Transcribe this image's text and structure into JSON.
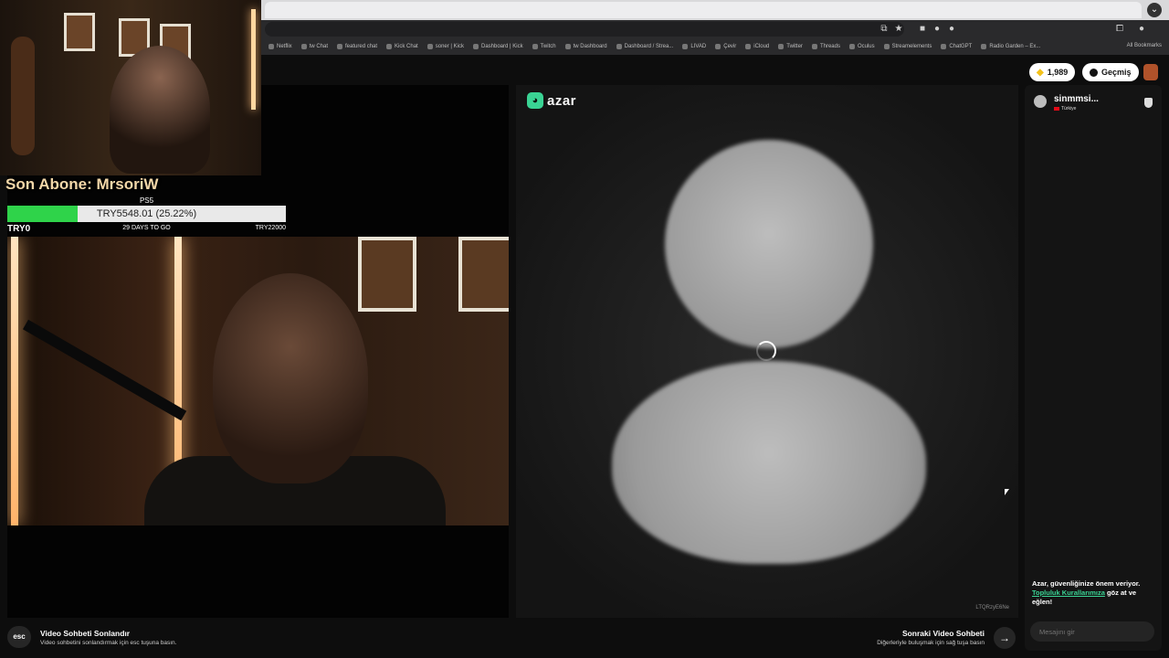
{
  "browser": {
    "bookmarks": [
      "Netflix",
      "tw Chat",
      "featured chat",
      "Kick Chat",
      "soner | Kick",
      "Dashboard | Kick",
      "Twitch",
      "tw Dashboard",
      "Dashboard / Strea...",
      "LIVAD",
      "Çevir",
      "iCloud",
      "Twitter",
      "Threads",
      "Oculus",
      "Streamelements",
      "ChatGPT",
      "Radio Garden – Ex..."
    ],
    "all_bookmarks": "All Bookmarks"
  },
  "stream_overlay": {
    "last_sub_label": "Son Abone: MrsoriW",
    "goal": {
      "title": "PS5",
      "current_text": "TRY5548.01 (25.22%)",
      "progress_percent": 25.22,
      "min_label": "TRY0",
      "days_left": "29 DAYS TO GO",
      "max_label": "TRY22000",
      "fill_color": "#2fd34a"
    }
  },
  "app": {
    "brand": "azar",
    "brand_color": "#3ad394",
    "gems_count": "1,989",
    "history_label": "Geçmiş"
  },
  "partner": {
    "username": "sinmmsi...",
    "country": "Türkiye",
    "session_id": "LTQRzyE6Ne"
  },
  "chat": {
    "notice_text": "Azar, güvenliğinize önem veriyor.",
    "notice_link": "Topluluk Kurallarımıza",
    "notice_suffix": " göz at ve eğlen!",
    "input_placeholder": "Mesajını gir"
  },
  "footer": {
    "esc_key": "esc",
    "end_title": "Video Sohbeti Sonlandır",
    "end_desc": "Video sohbetini sonlandırmak için esc tuşuna basın.",
    "next_title": "Sonraki Video Sohbeti",
    "next_desc": "Diğerleriyle buluşmak için sağ tuşa basın",
    "next_icon": "→"
  }
}
